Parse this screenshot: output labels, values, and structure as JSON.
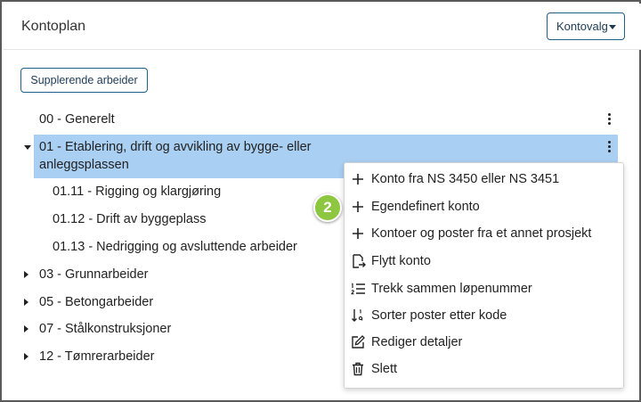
{
  "header": {
    "title": "Kontoplan",
    "account_options_label": "Kontovalg"
  },
  "toolbar": {
    "supplementary_label": "Supplerende arbeider"
  },
  "tree": {
    "items": [
      {
        "label": "00 - Generelt"
      },
      {
        "label_line1": "01 - Etablering, drift og avvikling av bygge- eller",
        "label_line2": "anleggsplassen"
      },
      {
        "label": "01.11 - Rigging og klargjøring"
      },
      {
        "label": "01.12 - Drift av byggeplass"
      },
      {
        "label": "01.13 - Nedrigging og avsluttende arbeider"
      },
      {
        "label": "03 - Grunnarbeider"
      },
      {
        "label": "05 - Betongarbeider"
      },
      {
        "label": "07 - Stålkonstruksjoner"
      },
      {
        "label": "12 - Tømrerarbeider"
      }
    ]
  },
  "context_menu": {
    "items": [
      {
        "label": "Konto fra NS 3450 eller NS 3451",
        "icon": "plus-icon"
      },
      {
        "label": "Egendefinert konto",
        "icon": "plus-icon"
      },
      {
        "label": "Kontoer og poster fra et annet prosjekt",
        "icon": "plus-icon"
      },
      {
        "label": "Flytt konto",
        "icon": "move-file-icon"
      },
      {
        "label": "Trekk sammen løpenummer",
        "icon": "numbered-list-icon"
      },
      {
        "label": "Sorter poster etter kode",
        "icon": "sort-icon"
      },
      {
        "label": "Rediger detaljer",
        "icon": "edit-icon"
      },
      {
        "label": "Slett",
        "icon": "trash-icon"
      }
    ]
  },
  "annotation": {
    "step": "2",
    "color": "#8dc63f"
  },
  "colors": {
    "selected_row": "#a9cff3",
    "accent_border": "#1f5f8a"
  }
}
